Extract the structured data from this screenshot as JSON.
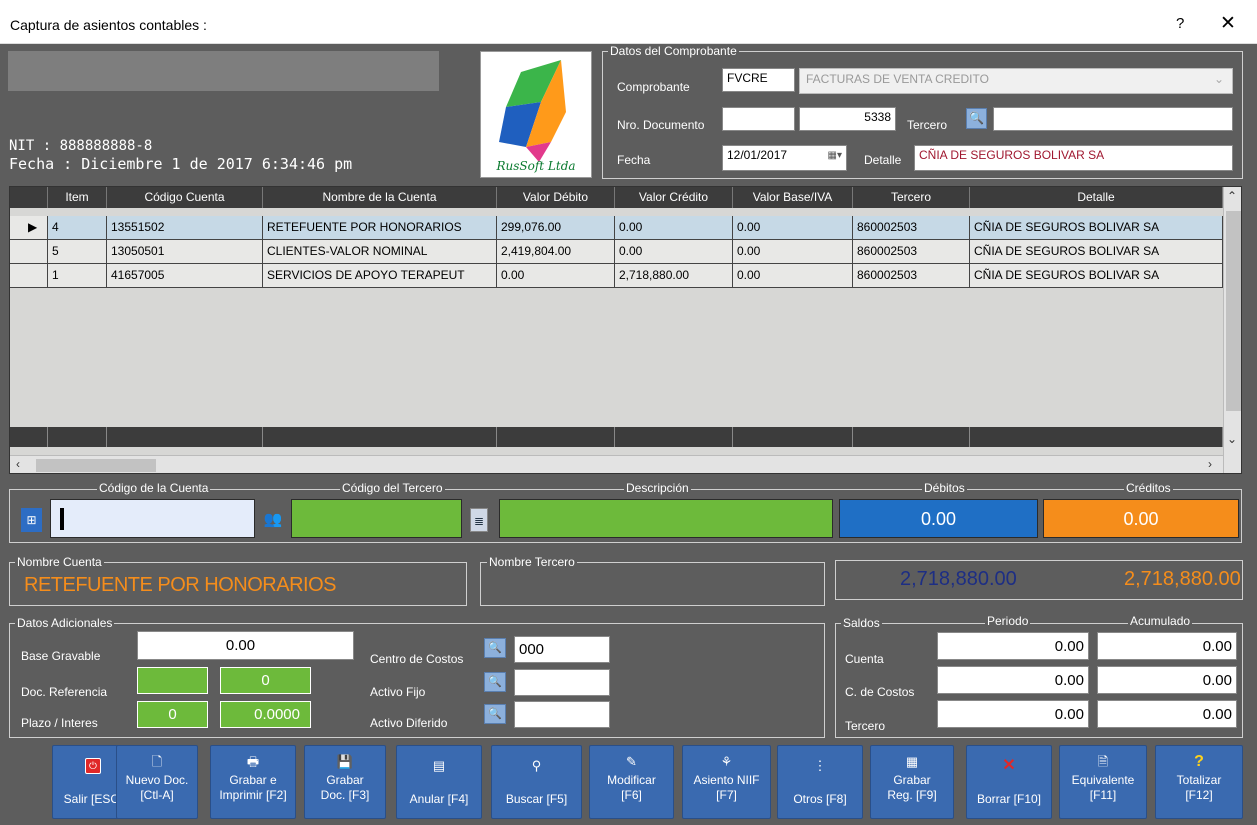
{
  "window": {
    "title": "Captura de asientos contables :",
    "help": "?",
    "close": "✕"
  },
  "company": {
    "nit": "NIT : 888888888-8",
    "fecha": "Fecha : Diciembre 1 de 2017   6:34:46 pm",
    "logo": "RusSoft Ltda"
  },
  "comprobante": {
    "legend": "Datos del Comprobante",
    "comprobante_label": "Comprobante",
    "code": "FVCRE",
    "name": "FACTURAS DE VENTA CREDITO",
    "nro_label": "Nro. Documento",
    "nro_prefix": "",
    "nro": "5338",
    "tercero_label": "Tercero",
    "tercero_value": "",
    "fecha_label": "Fecha",
    "fecha": "12/01/2017",
    "detalle_label": "Detalle",
    "detalle": "CÑIA DE SEGUROS BOLIVAR SA"
  },
  "grid": {
    "columns": [
      "Item",
      "Código Cuenta",
      "Nombre de la Cuenta",
      "Valor Débito",
      "Valor Crédito",
      "Valor Base/IVA",
      "Tercero",
      "Detalle"
    ],
    "rows": [
      [
        "4",
        "13551502",
        "RETEFUENTE POR HONORARIOS",
        "299,076.00",
        "0.00",
        "0.00",
        "860002503",
        "CÑIA DE SEGUROS BOLIVAR SA"
      ],
      [
        "5",
        "13050501",
        "CLIENTES-VALOR NOMINAL",
        "2,419,804.00",
        "0.00",
        "0.00",
        "860002503",
        "CÑIA DE SEGUROS BOLIVAR SA"
      ],
      [
        "1",
        "41657005",
        "SERVICIOS DE APOYO TERAPEUT",
        "0.00",
        "2,718,880.00",
        "0.00",
        "860002503",
        "CÑIA DE SEGUROS BOLIVAR SA"
      ]
    ]
  },
  "entry": {
    "codigo_cuenta_label": "Código de la Cuenta",
    "codigo_tercero_label": "Código del Tercero",
    "descripcion_label": "Descripción",
    "debitos_label": "Débitos",
    "creditos_label": "Créditos",
    "debitos": "0.00",
    "creditos": "0.00"
  },
  "nombres": {
    "cuenta_label": "Nombre Cuenta",
    "cuenta": "RETEFUENTE POR HONORARIOS",
    "tercero_label": "Nombre Tercero",
    "total_debitos": "2,718,880.00",
    "total_creditos": "2,718,880.00"
  },
  "adicionales": {
    "legend": "Datos Adicionales",
    "base_label": "Base Gravable",
    "base": "0.00",
    "docref_label": "Doc. Referencia",
    "docref_a": "",
    "docref_b": "0",
    "plazo_label": "Plazo / Interes",
    "plazo": "0",
    "interes": "0.0000",
    "centro_label": "Centro de Costos",
    "centro": "000",
    "activo_label": "Activo Fijo",
    "activo": "",
    "diferido_label": "Activo Diferido",
    "diferido": ""
  },
  "saldos": {
    "legend": "Saldos",
    "periodo": "Periodo",
    "acumulado": "Acumulado",
    "cuenta_label": "Cuenta",
    "costos_label": "C. de Costos",
    "tercero_label": "Tercero",
    "cuenta_p": "0.00",
    "cuenta_a": "0.00",
    "costos_p": "0.00",
    "costos_a": "0.00",
    "tercero_p": "0.00",
    "tercero_a": "0.00"
  },
  "toolbar": [
    {
      "l1": "",
      "l2": "Salir [ESC]",
      "icon": "power-icon"
    },
    {
      "l1": "Nuevo Doc.",
      "l2": "[Ctl-A]",
      "icon": "new-doc-icon"
    },
    {
      "l1": "Grabar e",
      "l2": "Imprimir [F2]",
      "icon": "print-icon"
    },
    {
      "l1": "Grabar",
      "l2": "Doc. [F3]",
      "icon": "save-icon"
    },
    {
      "l1": "",
      "l2": "Anular [F4]",
      "icon": "void-icon"
    },
    {
      "l1": "",
      "l2": "Buscar [F5]",
      "icon": "binoculars-icon"
    },
    {
      "l1": "Modificar",
      "l2": "[F6]",
      "icon": "edit-icon"
    },
    {
      "l1": "Asiento NIIF",
      "l2": "[F7]",
      "icon": "tree-icon"
    },
    {
      "l1": "",
      "l2": "Otros [F8]",
      "icon": "others-icon"
    },
    {
      "l1": "Grabar",
      "l2": "Reg. [F9]",
      "icon": "grid-save-icon"
    },
    {
      "l1": "",
      "l2": "Borrar [F10]",
      "icon": "delete-icon"
    },
    {
      "l1": "Equivalente",
      "l2": "[F11]",
      "icon": "document-icon"
    },
    {
      "l1": "Totalizar",
      "l2": "[F12]",
      "icon": "question-icon"
    }
  ],
  "colors": {
    "accent_orange": "#f58d1b",
    "entry_blue": "#1f6fc5",
    "entry_green": "#6dba3b",
    "total_blue": "#1d2e84"
  }
}
